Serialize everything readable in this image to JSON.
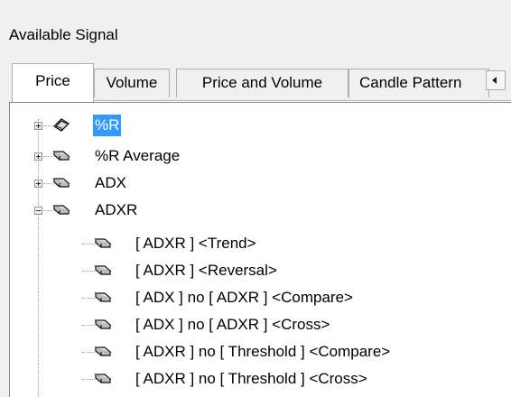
{
  "group_title": "Available Signal",
  "tabs": [
    {
      "label": "Price",
      "active": true
    },
    {
      "label": "Volume",
      "active": false
    },
    {
      "label": "Price and Volume",
      "active": false
    },
    {
      "label": "Candle Pattern",
      "active": false
    }
  ],
  "tab_scroll_icon": "scroll-left-icon",
  "tree": {
    "nodes": [
      {
        "label": "%R",
        "selected": true,
        "expander": "plus",
        "icon": "open-book-icon"
      },
      {
        "label": "%R Average",
        "selected": false,
        "expander": "plus",
        "icon": "book-icon"
      },
      {
        "label": "ADX",
        "selected": false,
        "expander": "plus",
        "icon": "book-icon"
      },
      {
        "label": "ADXR",
        "selected": false,
        "expander": "minus",
        "icon": "book-icon"
      }
    ],
    "children": [
      {
        "label": "[ ADXR ] <Trend>",
        "icon": "book-icon"
      },
      {
        "label": "[ ADXR ] <Reversal>",
        "icon": "book-icon"
      },
      {
        "label": "[ ADX ] no [ ADXR ] <Compare>",
        "icon": "book-icon"
      },
      {
        "label": "[ ADX ] no [ ADXR ] <Cross>",
        "icon": "book-icon"
      },
      {
        "label": "[ ADXR ] no [ Threshold ] <Compare>",
        "icon": "book-icon"
      },
      {
        "label": "[ ADXR ] no [ Threshold ] <Cross>",
        "icon": "book-icon"
      }
    ]
  },
  "colors": {
    "selection": "#3399ff",
    "background": "#f0f0f0"
  }
}
